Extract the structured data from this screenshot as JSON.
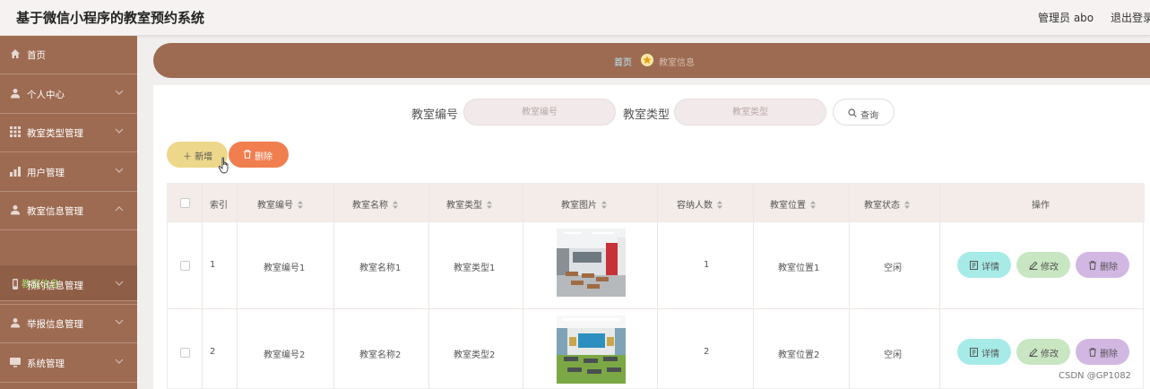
{
  "header": {
    "app_title": "基于微信小程序的教室预约系统",
    "admin_label": "管理员 abo",
    "logout": "退出登录"
  },
  "sidebar": {
    "items": [
      {
        "label": "首页",
        "icon": "home-icon"
      },
      {
        "label": "个人中心",
        "icon": "user-icon"
      },
      {
        "label": "教室类型管理",
        "icon": "grid-icon"
      },
      {
        "label": "用户管理",
        "icon": "chart-icon"
      },
      {
        "label": "教室信息管理",
        "icon": "user-icon"
      },
      {
        "label": "预约信息管理",
        "icon": "phone-icon"
      },
      {
        "label": "举报信息管理",
        "icon": "user-icon"
      },
      {
        "label": "系统管理",
        "icon": "monitor-icon"
      }
    ],
    "active_sub": "教室信息"
  },
  "breadcrumb": {
    "home": "首页",
    "current": "教室信息"
  },
  "search": {
    "code_label": "教室编号",
    "code_placeholder": "教室编号",
    "type_label": "教室类型",
    "type_placeholder": "教室类型",
    "query_button": "查询"
  },
  "actions": {
    "add": "新增",
    "delete": "删除"
  },
  "table": {
    "headers": [
      "索引",
      "教室编号",
      "教室名称",
      "教室类型",
      "教室图片",
      "容纳人数",
      "教室位置",
      "教室状态",
      "操作"
    ],
    "rows": [
      {
        "index": "1",
        "code": "教室编号1",
        "name": "教室名称1",
        "type": "教室类型1",
        "capacity": "1",
        "location": "教室位置1",
        "status": "空闲"
      },
      {
        "index": "2",
        "code": "教室编号2",
        "name": "教室名称2",
        "type": "教室类型2",
        "capacity": "2",
        "location": "教室位置2",
        "status": "空闲"
      }
    ],
    "row_actions": {
      "detail": "详情",
      "edit": "修改",
      "delete": "删除"
    }
  },
  "watermark": "CSDN @GP1082",
  "colors": {
    "sidebar": "#9d6b52",
    "active_sub_text": "#a7e072",
    "add_button": "#ecd78a",
    "delete_button": "#f07e4f",
    "detail_button": "#a7ebe8",
    "edit_button": "#c9e6c2",
    "row_delete_button": "#d3b7e3"
  }
}
